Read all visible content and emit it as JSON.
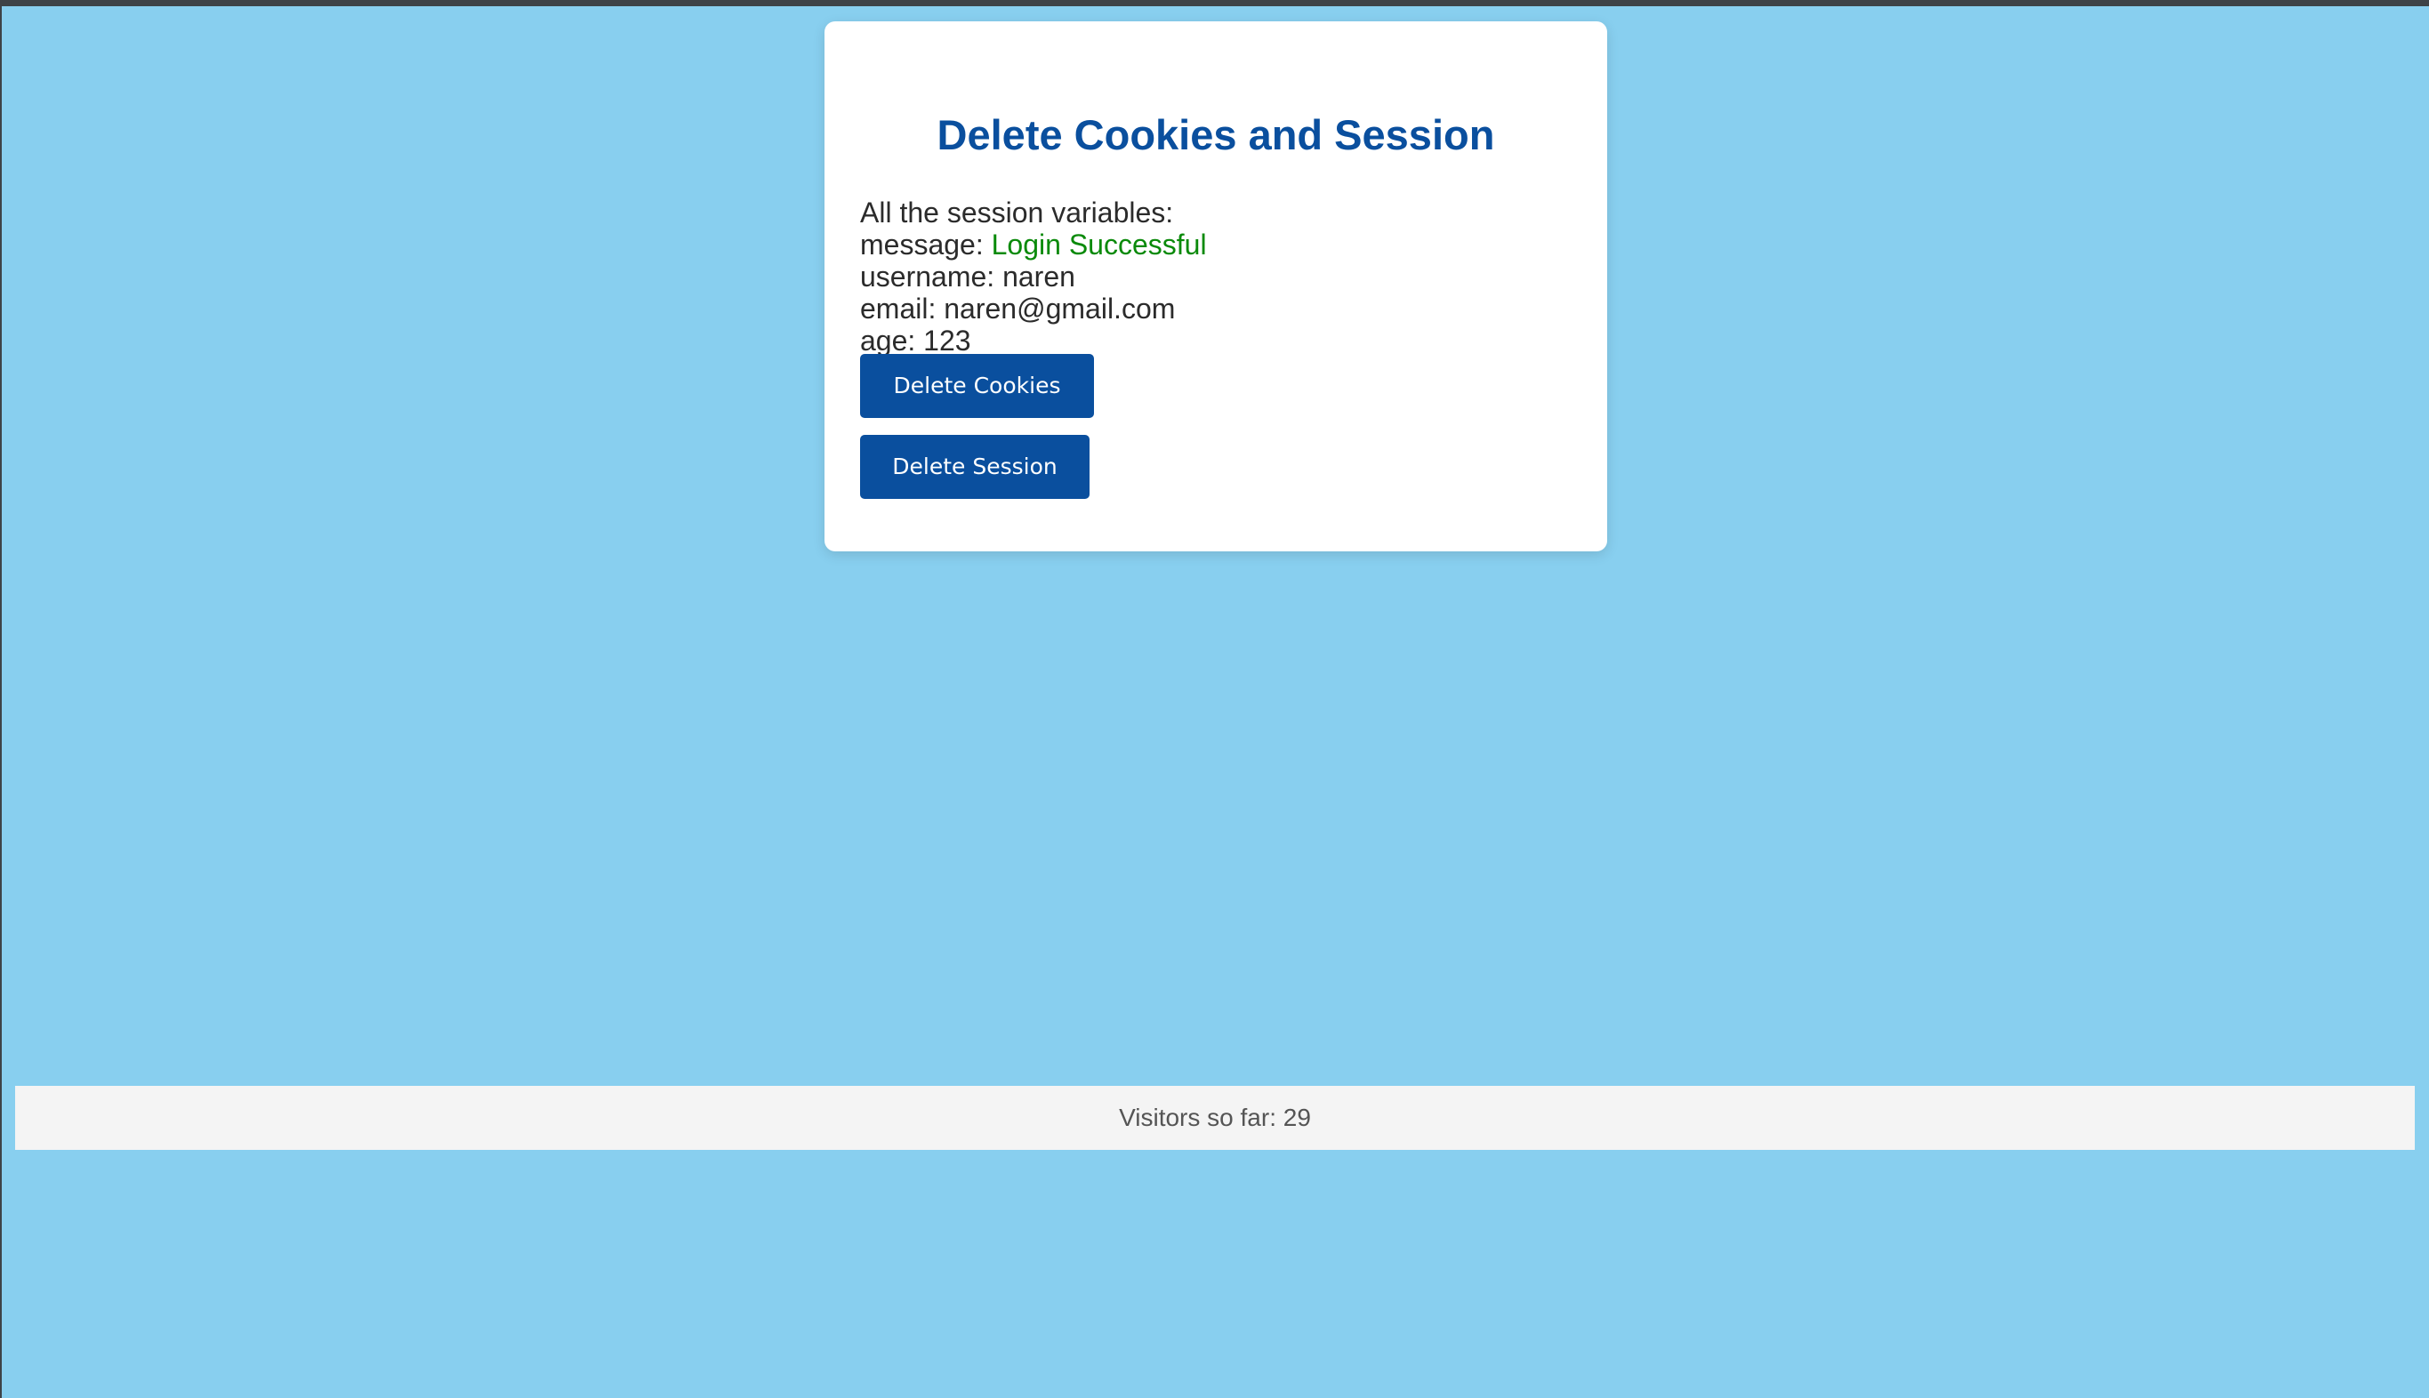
{
  "card": {
    "title": "Delete Cookies and Session",
    "intro": "All the session variables:",
    "variables": [
      {
        "key": "message:",
        "value": "Login Successful"
      },
      {
        "key": "username:",
        "value": "naren"
      },
      {
        "key": "email:",
        "value": "naren@gmail.com"
      },
      {
        "key": "age:",
        "value": "123"
      }
    ],
    "buttons": {
      "delete_cookies": "Delete Cookies",
      "delete_session": "Delete Session"
    }
  },
  "footer": {
    "visitors_text": "Visitors so far: 29"
  },
  "colors": {
    "background": "#88cfef",
    "accent": "#0a4f9e",
    "success": "#0a8a0a",
    "card": "#ffffff",
    "footer": "#f4f4f4"
  }
}
